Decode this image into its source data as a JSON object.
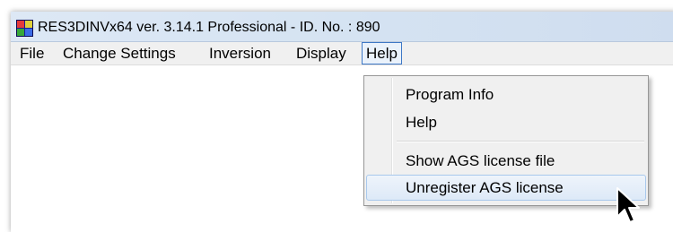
{
  "window": {
    "title": "RES3DINVx64 ver. 3.14.1 Professional - ID. No. : 890",
    "app_icon": "res3dinv-app-icon"
  },
  "menubar": {
    "items": [
      {
        "label": "File"
      },
      {
        "label": "Change Settings"
      },
      {
        "label": "Inversion"
      },
      {
        "label": "Display"
      },
      {
        "label": "Help",
        "active": true
      }
    ]
  },
  "help_menu": {
    "items": [
      {
        "label": "Program Info"
      },
      {
        "label": "Help"
      },
      {
        "label": "Show AGS license file"
      },
      {
        "label": "Unregister AGS license",
        "highlighted": true
      }
    ]
  },
  "cursor": {
    "icon": "arrow-pointer-icon"
  }
}
